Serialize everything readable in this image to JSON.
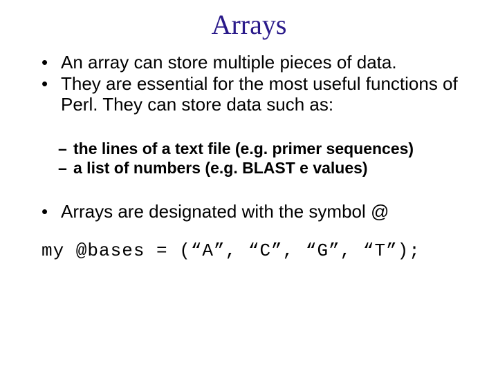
{
  "title": "Arrays",
  "bullets": {
    "b1": "An array can store multiple pieces of data.",
    "b2": "They are essential for the most useful functions of Perl. They can store data such as:",
    "b3": "Arrays are designated with the symbol @"
  },
  "sub": {
    "s1": "the lines of a text file (e.g. primer sequences)",
    "s2": "a list of numbers (e.g. BLAST e values)"
  },
  "code": "my @bases = (“A”, “C”, “G”, “T”);"
}
